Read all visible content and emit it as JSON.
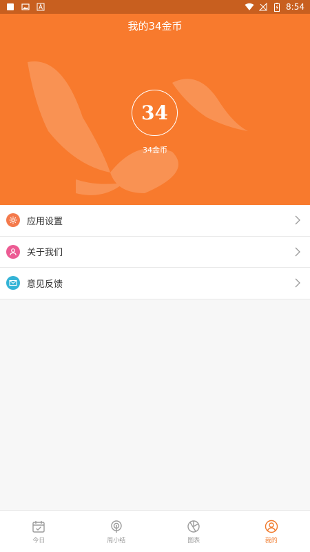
{
  "status_bar": {
    "time": "8:54"
  },
  "hero": {
    "title": "我的34金币",
    "coin_count": "34",
    "coin_label": "34金币"
  },
  "menu": {
    "items": [
      {
        "label": "应用设置",
        "icon": "gear-icon",
        "color": "#f47a4c"
      },
      {
        "label": "关于我们",
        "icon": "user-icon",
        "color": "#ec5b93"
      },
      {
        "label": "意见反馈",
        "icon": "mail-icon",
        "color": "#33b3d6"
      }
    ]
  },
  "tabbar": {
    "tabs": [
      {
        "label": "今日",
        "icon": "calendar-icon"
      },
      {
        "label": "周小结",
        "icon": "radio-icon"
      },
      {
        "label": "图表",
        "icon": "chart-icon"
      },
      {
        "label": "我的",
        "icon": "profile-icon",
        "active": true
      }
    ]
  },
  "colors": {
    "accent": "#f87a2d",
    "tab_active": "#f07a2c",
    "status_bar": "#c85f1f"
  }
}
